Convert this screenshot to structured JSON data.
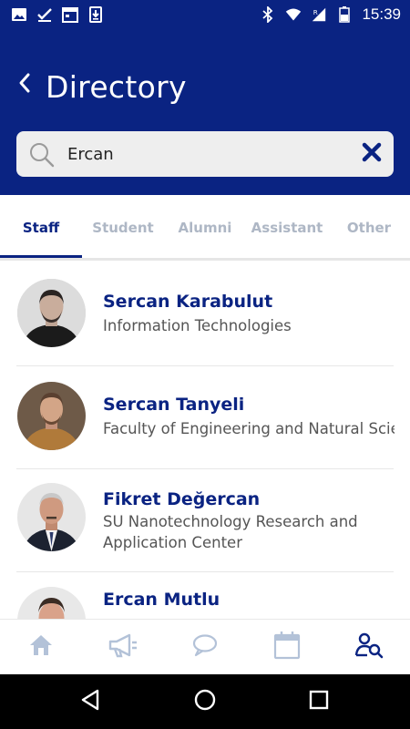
{
  "status_bar": {
    "time": "15:39",
    "left_icons": [
      "image-icon",
      "check-icon",
      "calendar-icon",
      "download-icon"
    ],
    "right_icons": [
      "bluetooth-icon",
      "wifi-icon",
      "signal-icon",
      "battery-icon"
    ]
  },
  "header": {
    "title": "Directory",
    "back_icon": "chevron-left-icon"
  },
  "search": {
    "value": "Ercan",
    "placeholder": ""
  },
  "tabs": [
    {
      "label": "Staff",
      "active": true
    },
    {
      "label": "Student",
      "active": false
    },
    {
      "label": "Alumni",
      "active": false
    },
    {
      "label": "Assistant",
      "active": false
    },
    {
      "label": "Other",
      "active": false
    }
  ],
  "people": [
    {
      "name": "Sercan Karabulut",
      "department": "Information Technologies"
    },
    {
      "name": "Sercan Tanyeli",
      "department": "Faculty of Engineering and Natural Sciences"
    },
    {
      "name": "Fikret Değercan",
      "department": "SU Nanotechnology Research and Application Center"
    },
    {
      "name": "Ercan Mutlu",
      "department": ""
    }
  ],
  "bottom_nav": [
    {
      "icon": "home-icon",
      "active": false
    },
    {
      "icon": "megaphone-icon",
      "active": false
    },
    {
      "icon": "chat-icon",
      "active": false
    },
    {
      "icon": "calendar-icon",
      "active": false
    },
    {
      "icon": "directory-search-icon",
      "active": true
    }
  ],
  "colors": {
    "brand": "#0a2382",
    "inactive": "#aeb7c5",
    "nav_inactive": "#b3c2d8"
  }
}
